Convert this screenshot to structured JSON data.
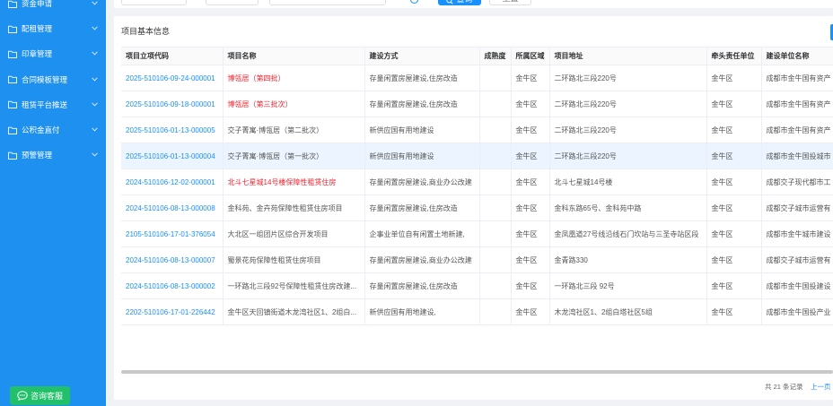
{
  "sidebar": {
    "items": [
      {
        "label": "资金申请"
      },
      {
        "label": "配租管理"
      },
      {
        "label": "印章管理"
      },
      {
        "label": "合同模板管理"
      },
      {
        "label": "租赁平台推送"
      },
      {
        "label": "公积金直付"
      },
      {
        "label": "预警管理"
      }
    ],
    "item_icon": "folder-icon",
    "expand_icon": "chevron-down-icon",
    "service_button": {
      "label": "咨询客服",
      "icon": "chat-icon"
    }
  },
  "filter": {
    "search_button": "查询",
    "search_icon": "search-icon",
    "reset_button": "重置"
  },
  "main": {
    "title": "项目基本信息",
    "table": {
      "columns": [
        "项目立项代码",
        "项目名称",
        "建设方式",
        "成熟度",
        "所属区域",
        "项目地址",
        "牵头责任单位",
        "建设单位名称"
      ],
      "rows": [
        {
          "code": "2025-510106-09-24-000001",
          "name": "博瓴居（第四批）",
          "name_alert": true,
          "method": "存量闲置房屋建设,住房改造",
          "region": "金牛区",
          "address": "二环路北三段220号",
          "lead_unit": "金牛区",
          "builder": "成都市金牛国有资产"
        },
        {
          "code": "2025-510106-09-18-000001",
          "name": "博瓴居（第三批次）",
          "name_alert": true,
          "method": "存量闲置房屋建设,住房改造",
          "region": "金牛区",
          "address": "二环路北三段220号",
          "lead_unit": "金牛区",
          "builder": "成都市金牛国有资产"
        },
        {
          "code": "2025-510106-01-13-000005",
          "name": "交子菁寓·博瓴居（第二批次）",
          "method": "新供应国有用地建设",
          "region": "金牛区",
          "address": "二环路北三段220号",
          "lead_unit": "金牛区",
          "builder": "成都市金牛国有资产"
        },
        {
          "code": "2025-510106-01-13-000004",
          "name": "交子菁寓·博瓴居（第一批次）",
          "method": "新供应国有用地建设",
          "region": "金牛区",
          "address": "二环路北三段220号",
          "lead_unit": "金牛区",
          "builder": "成都市金牛国投城市",
          "selected": true
        },
        {
          "code": "2024-510106-12-02-000001",
          "name": "北斗七星城14号楼保障性租赁住房",
          "name_alert": true,
          "method": "存量闲置房屋建设,商业办公改建",
          "region": "金牛区",
          "address": "北斗七星城14号楼",
          "lead_unit": "金牛区",
          "builder": "成都交子现代都市工"
        },
        {
          "code": "2024-510106-08-13-000008",
          "name": "金科苑、金卉苑保障性租赁住房项目",
          "method": "存量闲置房屋建设,住房改造",
          "region": "金牛区",
          "address": "金科东路65号、金科苑中路",
          "lead_unit": "金牛区",
          "builder": "成都交子城市运营有"
        },
        {
          "code": "2105-510106-17-01-376054",
          "name": "大北区一组团片区综合开发项目",
          "method": "企事业单位自有闲置土地新建,",
          "region": "金牛区",
          "address": "金凤凰道27号线沿线石门坎站与三圣寺站区段",
          "lead_unit": "金牛区",
          "builder": "成都市金牛城市建设"
        },
        {
          "code": "2024-510106-08-13-000007",
          "name": "蜀景花苑保障性租赁住房项目",
          "method": "存量闲置房屋建设,商业办公改建",
          "region": "金牛区",
          "address": "金青路330",
          "lead_unit": "金牛区",
          "builder": "成都交子城市运营有"
        },
        {
          "code": "2024-510106-08-13-000002",
          "name": "一环路北三段92号保障性租赁住房改建...",
          "method": "存量闲置房屋建设,住房改造",
          "region": "金牛区",
          "address": "一环路北三段 92号",
          "lead_unit": "金牛区",
          "builder": "成都市金牛国投建设"
        },
        {
          "code": "2202-510106-17-01-226442",
          "name": "金牛区天回镇街道木龙湾社区1、2组白...",
          "method": "新供应国有用地建设,",
          "region": "金牛区",
          "address": "木龙湾社区1、2组白塔社区5组",
          "lead_unit": "金牛区",
          "builder": "成都市金牛国投产业"
        }
      ]
    },
    "pagination": {
      "total": "共 21 条记录",
      "prev": "上一页"
    }
  },
  "colors": {
    "sidebar": "#1e90f0",
    "accent": "#1890ff",
    "alert": "#f5222d",
    "service": "#22c06b",
    "selected_row": "#ecf5ff"
  }
}
